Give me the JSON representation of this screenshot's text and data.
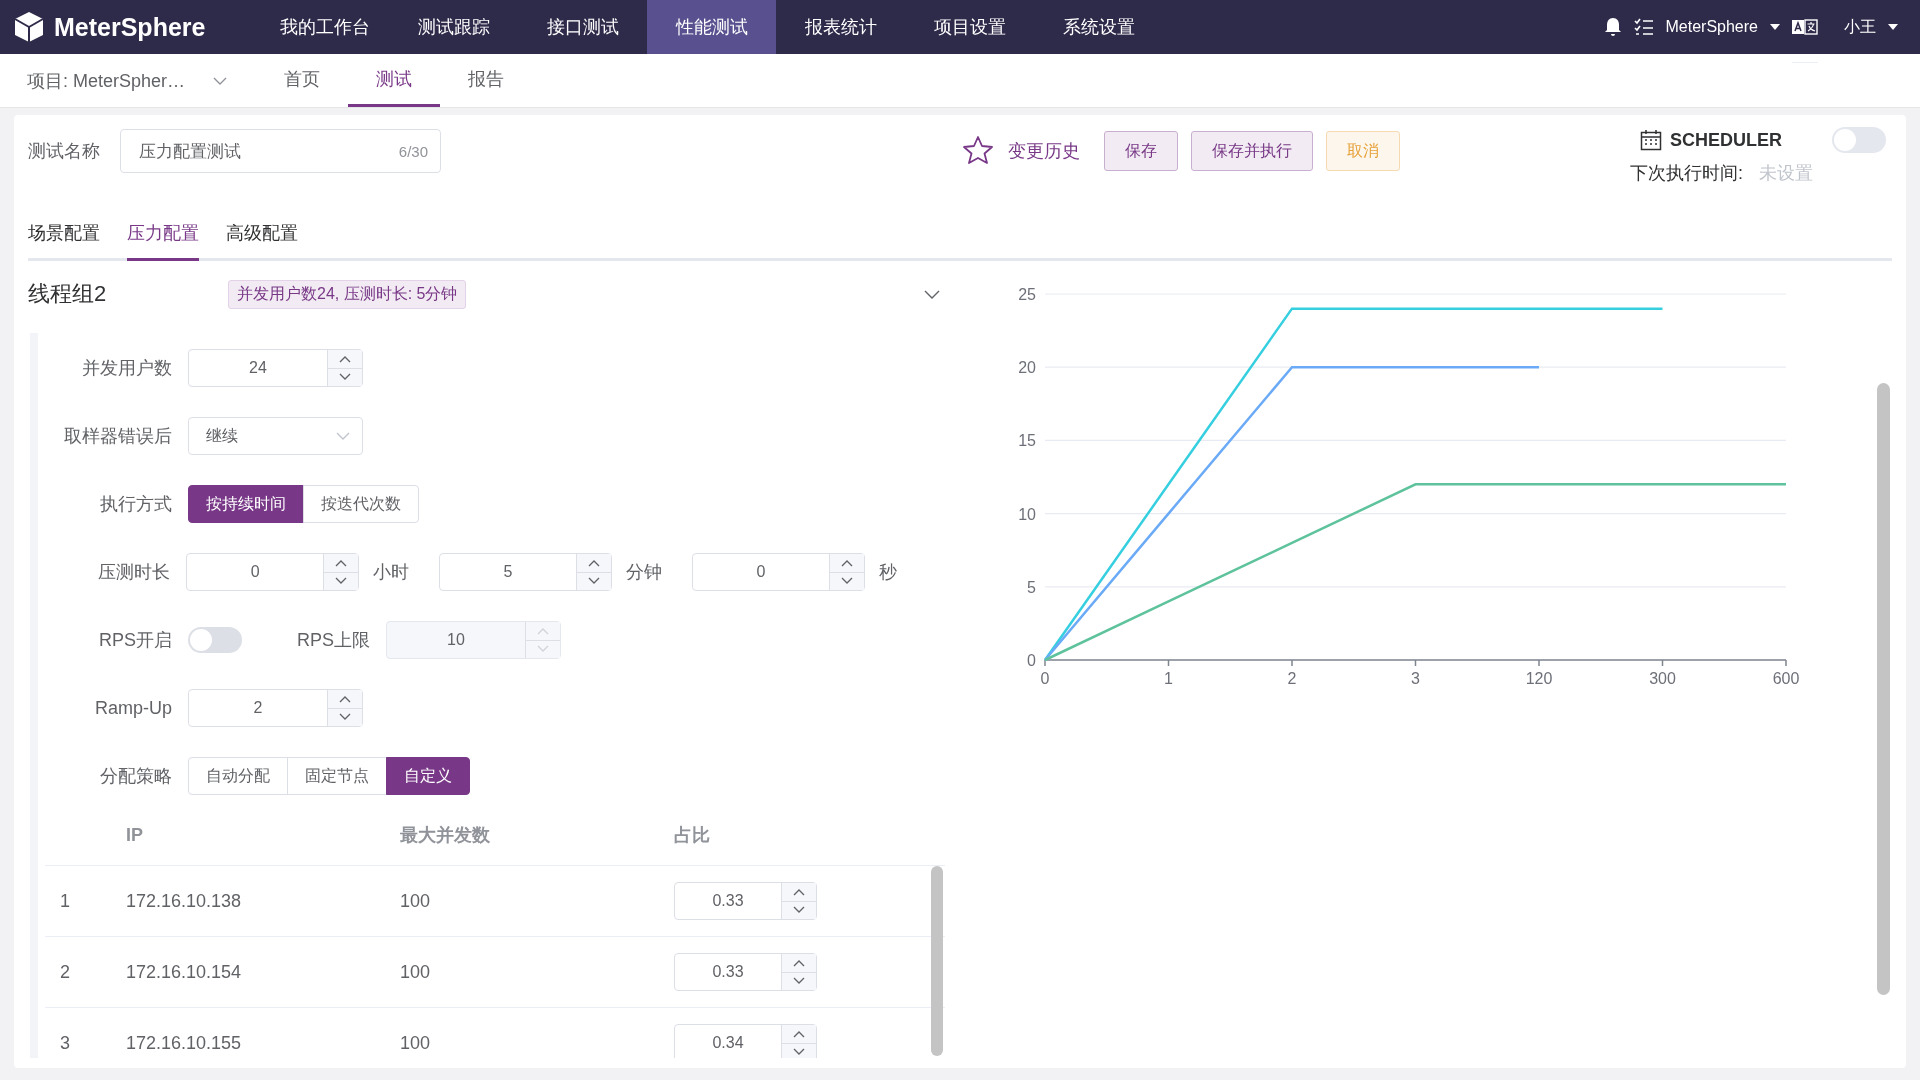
{
  "top_nav": {
    "logo": "MeterSphere",
    "items": [
      {
        "label": "我的工作台",
        "selected": false
      },
      {
        "label": "测试跟踪",
        "selected": false
      },
      {
        "label": "接口测试",
        "selected": false
      },
      {
        "label": "性能测试",
        "selected": true
      },
      {
        "label": "报表统计",
        "selected": false
      },
      {
        "label": "项目设置",
        "selected": false
      },
      {
        "label": "系统设置",
        "selected": false
      }
    ],
    "workspace": "MeterSphere",
    "user": "小王"
  },
  "sub_nav": {
    "project": "项目: MeterSpher…",
    "tabs": [
      {
        "label": "首页",
        "selected": false
      },
      {
        "label": "测试",
        "selected": true
      },
      {
        "label": "报告",
        "selected": false
      }
    ]
  },
  "test": {
    "name_label": "测试名称",
    "name_value": "压力配置测试",
    "name_count": "6/30",
    "history": "变更历史",
    "buttons": [
      {
        "label": "保存",
        "kind": "plain"
      },
      {
        "label": "保存并执行",
        "kind": "plain"
      },
      {
        "label": "取消",
        "kind": "warning"
      }
    ]
  },
  "scheduler": {
    "title": "SCHEDULER",
    "on": false,
    "next_label": "下次执行时间:",
    "next_value": "未设置"
  },
  "config_tabs": [
    {
      "label": "场景配置",
      "selected": false
    },
    {
      "label": "压力配置",
      "selected": true
    },
    {
      "label": "高级配置",
      "selected": false
    }
  ],
  "thread_group": {
    "title": "线程组2",
    "summary": "并发用户数24, 压测时长: 5分钟",
    "concurrency": {
      "label": "并发用户数",
      "value": "24"
    },
    "on_error": {
      "label": "取样器错误后",
      "value": "继续"
    },
    "exec_mode": {
      "label": "执行方式",
      "options": [
        {
          "label": "按持续时间",
          "selected": true
        },
        {
          "label": "按迭代次数",
          "selected": false
        }
      ]
    },
    "duration": {
      "label": "压测时长",
      "parts": [
        {
          "value": "0",
          "unit": "小时"
        },
        {
          "value": "5",
          "unit": "分钟"
        },
        {
          "value": "0",
          "unit": "秒"
        }
      ]
    },
    "rps": {
      "label": "RPS开启",
      "on": false,
      "limit_label": "RPS上限",
      "limit_value": "10",
      "limit_disabled": true
    },
    "ramp_up": {
      "label": "Ramp-Up",
      "value": "2"
    },
    "strategy": {
      "label": "分配策略",
      "options": [
        {
          "label": "自动分配",
          "selected": false
        },
        {
          "label": "固定节点",
          "selected": false
        },
        {
          "label": "自定义",
          "selected": true
        }
      ]
    },
    "nodes": {
      "columns": [
        "IP",
        "最大并发数",
        "占比"
      ],
      "rows": [
        {
          "index": "1",
          "ip": "172.16.10.138",
          "max": "100",
          "ratio": "0.33"
        },
        {
          "index": "2",
          "ip": "172.16.10.154",
          "max": "100",
          "ratio": "0.33"
        },
        {
          "index": "3",
          "ip": "172.16.10.155",
          "max": "100",
          "ratio": "0.34"
        }
      ]
    },
    "chart_data": {
      "type": "line",
      "grid": true,
      "categories": [
        "0",
        "1",
        "2",
        "3",
        "120",
        "300",
        "600"
      ],
      "ylim": [
        0,
        25
      ],
      "yticks": [
        0,
        5,
        10,
        15,
        20,
        25
      ],
      "series": [
        {
          "color": "#36cfe0",
          "values": [
            0,
            12,
            24,
            24,
            24,
            24,
            null
          ]
        },
        {
          "color": "#6aaaf6",
          "values": [
            0,
            10,
            20,
            20,
            20,
            null,
            null
          ]
        },
        {
          "color": "#5ec39c",
          "values": [
            0,
            4,
            8,
            12,
            12,
            12,
            12
          ]
        }
      ]
    }
  }
}
